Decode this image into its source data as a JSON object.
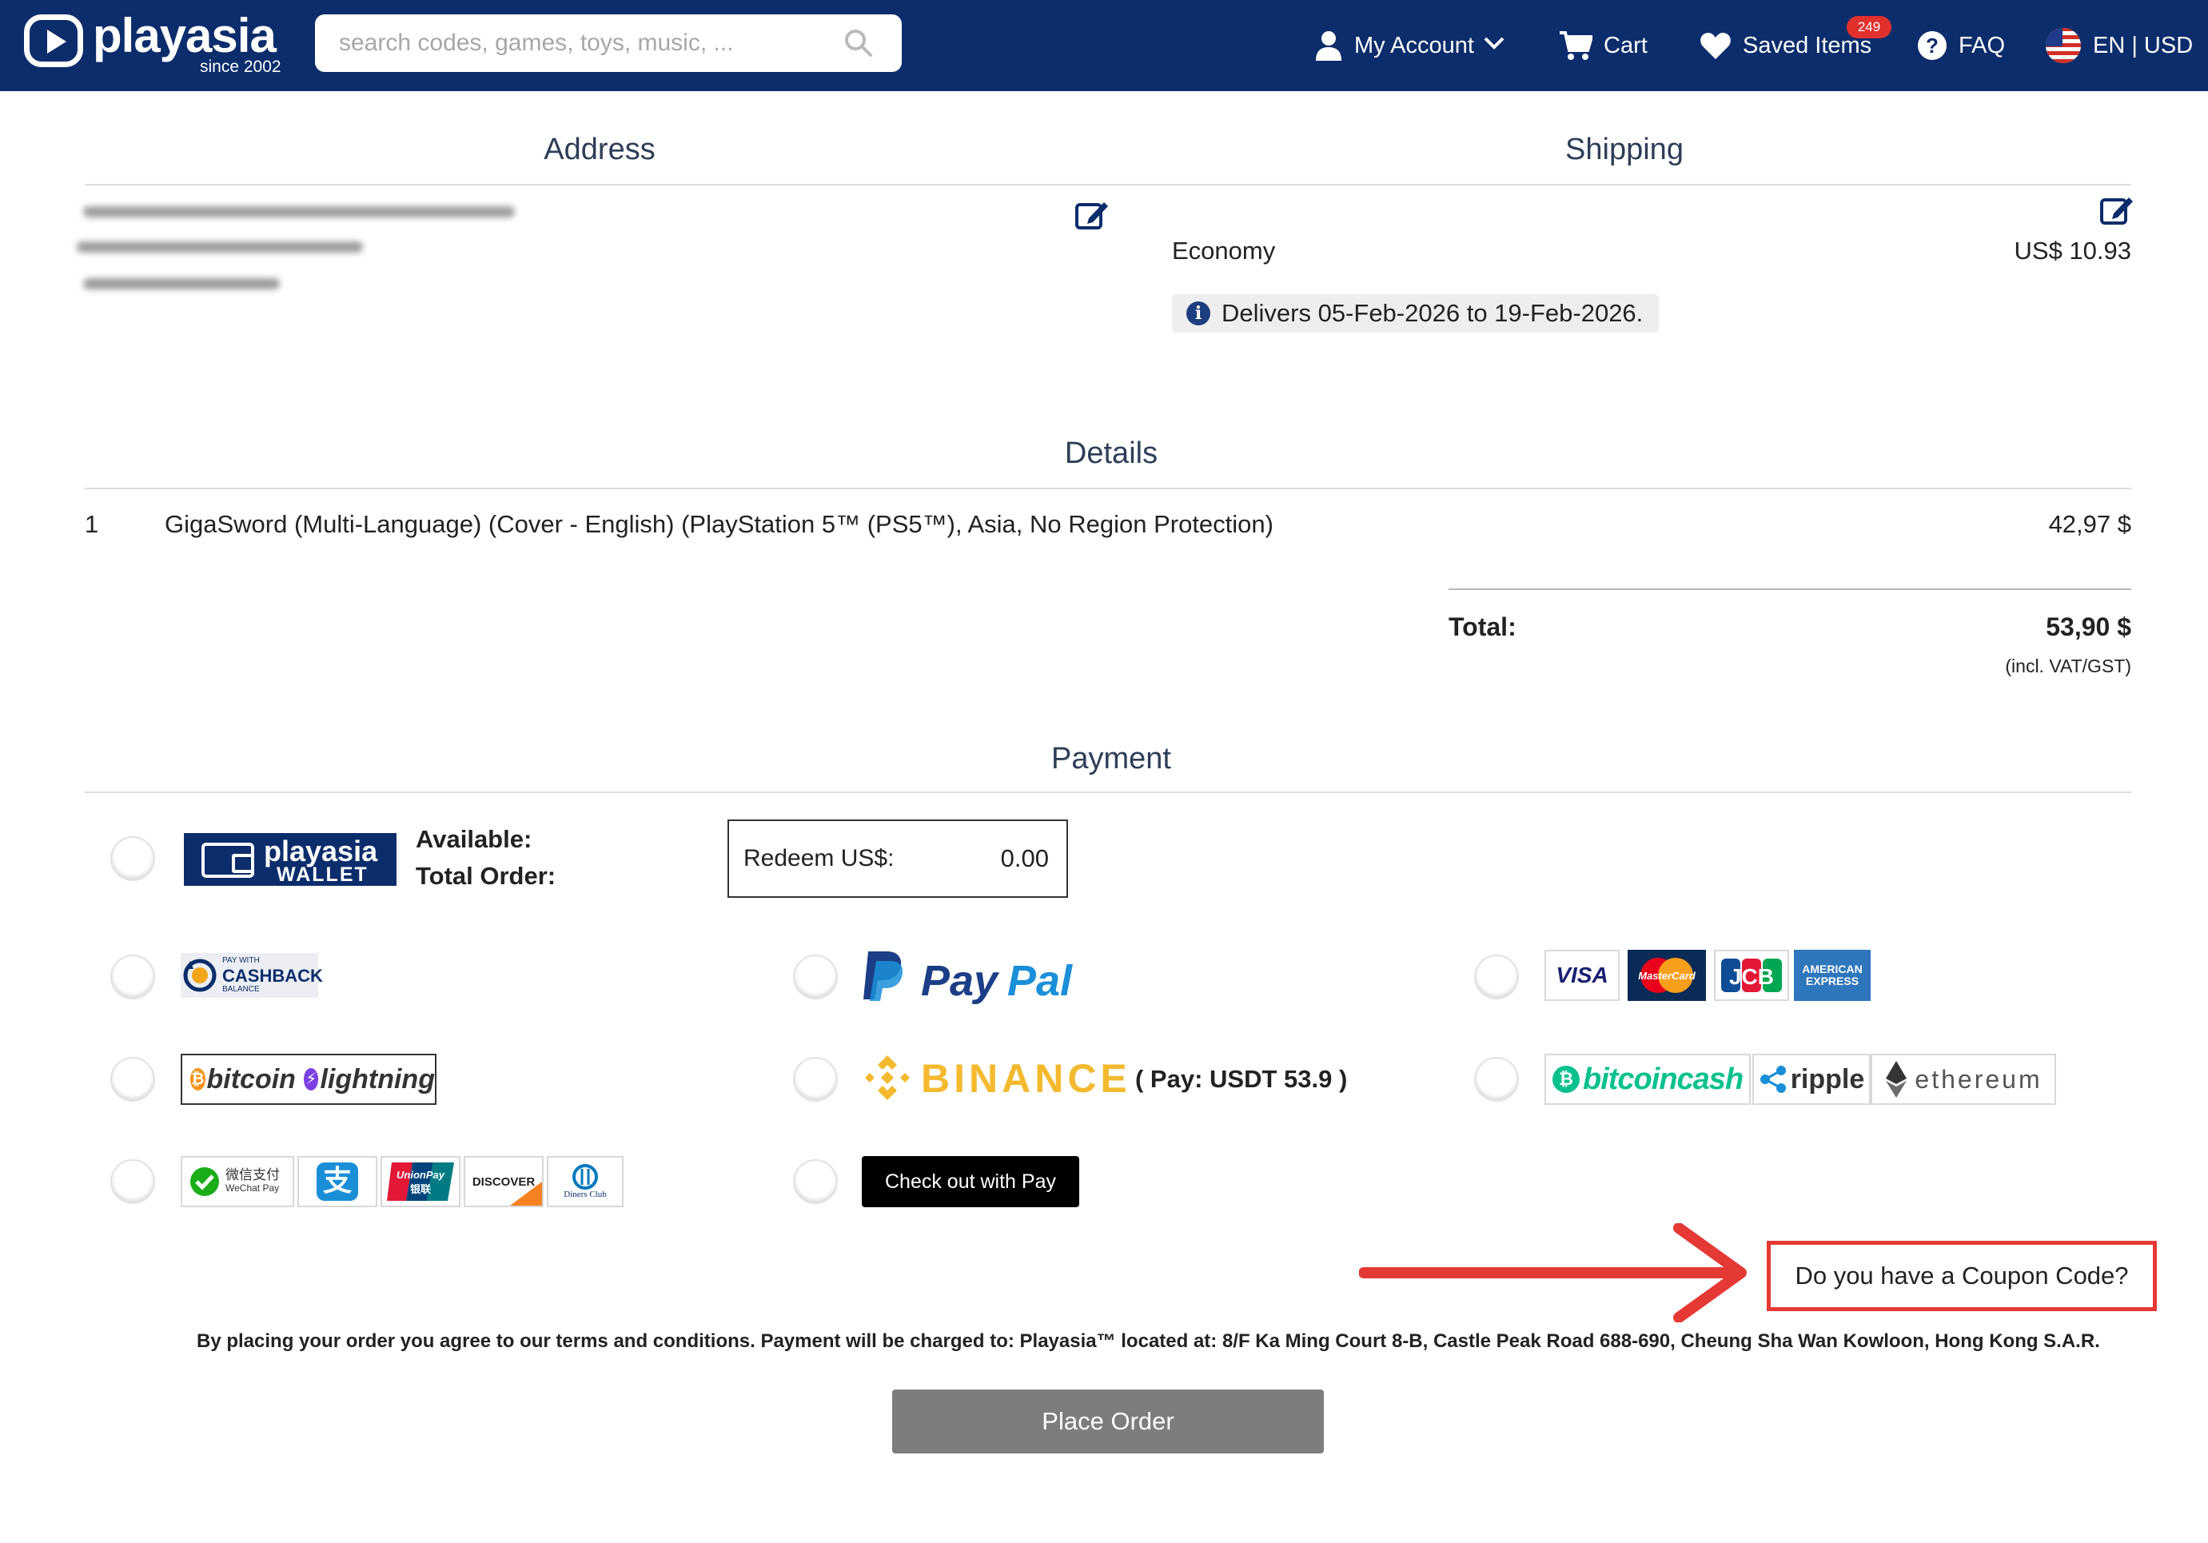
{
  "header": {
    "logo_text": "playasia",
    "logo_tagline": "since 2002",
    "search_placeholder": "search codes, games, toys, music, ...",
    "my_account": "My Account",
    "cart": "Cart",
    "saved_items": "Saved Items",
    "saved_count": "249",
    "faq": "FAQ",
    "locale": "EN | USD"
  },
  "address": {
    "title": "Address"
  },
  "shipping": {
    "title": "Shipping",
    "method": "Economy",
    "price": "US$ 10.93",
    "delivers": "Delivers 05-Feb-2026 to 19-Feb-2026."
  },
  "details": {
    "title": "Details",
    "items": [
      {
        "qty": "1",
        "name": "GigaSword (Multi-Language) (Cover - English) (PlayStation 5™ (PS5™), Asia, No Region Protection)",
        "price": "42,97 $"
      }
    ],
    "total_label": "Total:",
    "total_value": "53,90 $",
    "total_note": "(incl. VAT/GST)"
  },
  "payment": {
    "title": "Payment",
    "wallet_line1": "playasia",
    "wallet_line2": "WALLET",
    "available_label": "Available:",
    "total_order_label": "Total Order:",
    "redeem_label": "Redeem US$:",
    "redeem_value": "0.00",
    "cashback_small": "PAY WITH",
    "cashback_big": "CASHBACK",
    "cashback_sub": "BALANCE",
    "paypal_1": "Pay",
    "paypal_2": "Pal",
    "cards": [
      "VISA",
      "MasterCard",
      "JCB",
      "AMERICAN EXPRESS"
    ],
    "bitcoin": "bitcoin",
    "lightning": "lightning",
    "binance": "BINANCE",
    "binance_amount": "( Pay: USDT 53.9 )",
    "bitcoincash": "bitcoincash",
    "ripple": "ripple",
    "ethereum": "ethereum",
    "wechat_cn": "微信支付",
    "wechat_en": "WeChat Pay",
    "alipay": "支",
    "unionpay": "UnionPay",
    "unionpay_cn": "银联",
    "discover": "DISCOVER",
    "diners": "Diners Club",
    "applepay": "Check out with  Pay",
    "coupon": "Do you have a Coupon Code?",
    "terms": "By placing your order you agree to our terms and conditions. Payment will be charged to: Playasia™ located at: 8/F Ka Ming Court 8-B, Castle Peak Road 688-690, Cheung Sha Wan Kowloon, Hong Kong S.A.R.",
    "place_order": "Place Order"
  },
  "colors": {
    "header_bg": "#0c2d6b",
    "accent_red": "#e53935",
    "button_gray": "#7d7d7d"
  }
}
